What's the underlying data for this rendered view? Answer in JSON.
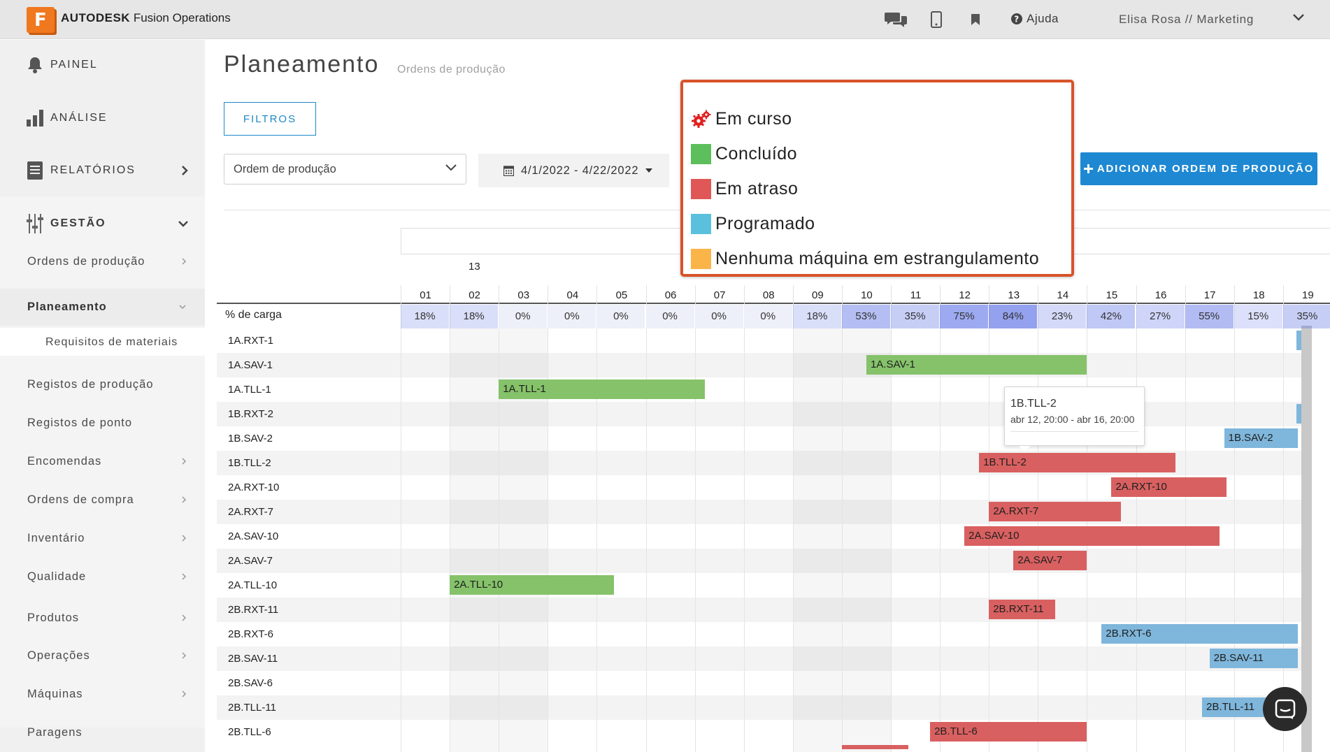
{
  "topbar": {
    "logo_letter": "F",
    "brand": "AUTODESK",
    "product": "Fusion Operations",
    "help_label": "Ajuda",
    "user_label": "Elisa Rosa // Marketing",
    "icons": [
      "chat-icon",
      "mobile-icon",
      "bookmark-icon",
      "help-icon",
      "chevron-down-icon"
    ]
  },
  "sidebar": {
    "top_items": [
      {
        "label": "PAINEL",
        "icon": "bell-icon"
      },
      {
        "label": "ANÁLISE",
        "icon": "bar-chart-icon"
      },
      {
        "label": "RELATÓRIOS",
        "icon": "report-icon"
      },
      {
        "label": "GESTÃO",
        "icon": "sliders-icon"
      }
    ],
    "sub_items": [
      "Ordens de produção",
      "Planeamento",
      "Requisitos de materiais",
      "Registos de produção",
      "Registos de ponto",
      "Encomendas",
      "Ordens de compra",
      "Inventário",
      "Qualidade",
      "Produtos",
      "Operações",
      "Máquinas",
      "Paragens"
    ]
  },
  "header": {
    "title": "Planeamento",
    "subtitle": "Ordens de produção",
    "filter_label": "FILTROS",
    "select_value": "Ordem de produção",
    "date_range": "4/1/2022 - 4/22/2022",
    "add_button_label": "ADICIONAR ORDEM DE PRODUÇÃO"
  },
  "legend": {
    "items": [
      {
        "label": "Em curso",
        "color": "#e02020",
        "icon": "gears-icon"
      },
      {
        "label": "Concluído",
        "color": "#5cbf5c"
      },
      {
        "label": "Em atraso",
        "color": "#e05757"
      },
      {
        "label": "Programado",
        "color": "#5bc0de"
      },
      {
        "label": "Nenhuma máquina em estrangulamento",
        "color": "#fbb448"
      }
    ]
  },
  "gantt": {
    "week_label": "13",
    "load_label": "% de carga",
    "days": [
      "01",
      "02",
      "03",
      "04",
      "05",
      "06",
      "07",
      "08",
      "09",
      "10",
      "11",
      "12",
      "13",
      "14",
      "15",
      "16",
      "17",
      "18",
      "19"
    ],
    "loads": [
      "18%",
      "18%",
      "0%",
      "0%",
      "0%",
      "0%",
      "0%",
      "0%",
      "18%",
      "53%",
      "35%",
      "75%",
      "84%",
      "23%",
      "42%",
      "27%",
      "55%",
      "15%",
      "35%"
    ],
    "rows": [
      "1A.RXT-1",
      "1A.SAV-1",
      "1A.TLL-1",
      "1B.RXT-2",
      "1B.SAV-2",
      "1B.TLL-2",
      "2A.RXT-10",
      "2A.RXT-7",
      "2A.SAV-10",
      "2A.SAV-7",
      "2A.TLL-10",
      "2B.RXT-11",
      "2B.RXT-6",
      "2B.SAV-11",
      "2B.SAV-6",
      "2B.TLL-11",
      "2B.TLL-6"
    ],
    "bars": [
      {
        "row": 1,
        "label": "1A.SAV-1",
        "status": "done",
        "start": 9.5,
        "end": 14.0
      },
      {
        "row": 2,
        "label": "1A.TLL-1",
        "status": "done",
        "start": 2.0,
        "end": 6.2
      },
      {
        "row": 4,
        "label": "1B.SAV-2",
        "status": "scheduled",
        "start": 16.8,
        "end": 18.3
      },
      {
        "row": 5,
        "label": "1B.TLL-2",
        "status": "late",
        "start": 11.8,
        "end": 15.8
      },
      {
        "row": 6,
        "label": "2A.RXT-10",
        "status": "late",
        "start": 14.5,
        "end": 16.85
      },
      {
        "row": 7,
        "label": "2A.RXT-7",
        "status": "late",
        "start": 12.0,
        "end": 14.7
      },
      {
        "row": 8,
        "label": "2A.SAV-10",
        "status": "late",
        "start": 11.5,
        "end": 16.7
      },
      {
        "row": 9,
        "label": "2A.SAV-7",
        "status": "late",
        "start": 12.5,
        "end": 14.0
      },
      {
        "row": 10,
        "label": "2A.TLL-10",
        "status": "done",
        "start": 1.0,
        "end": 4.35
      },
      {
        "row": 11,
        "label": "2B.RXT-11",
        "status": "late",
        "start": 12.0,
        "end": 13.35
      },
      {
        "row": 12,
        "label": "2B.RXT-6",
        "status": "scheduled",
        "start": 14.3,
        "end": 18.3
      },
      {
        "row": 13,
        "label": "2B.SAV-11",
        "status": "scheduled",
        "start": 16.5,
        "end": 18.3
      },
      {
        "row": 15,
        "label": "2B.TLL-11",
        "status": "scheduled",
        "start": 16.35,
        "end": 18.3
      },
      {
        "row": 16,
        "label": "2B.TLL-6",
        "status": "late",
        "start": 10.8,
        "end": 14.0
      }
    ],
    "tooltip": {
      "title": "1B.TLL-2",
      "range": "abr 12, 20:00 - abr 16, 20:00"
    }
  },
  "colors": {
    "done": "#85c26a",
    "late": "#d96060",
    "scheduled": "#7fb6db",
    "accent": "#1e88d2",
    "legend_border": "#d8532a"
  }
}
